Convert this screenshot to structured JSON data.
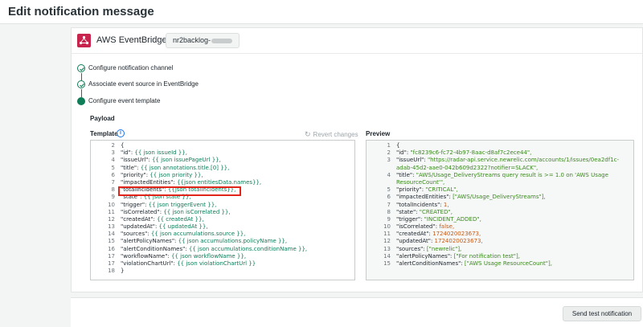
{
  "page": {
    "title": "Edit notification message"
  },
  "header": {
    "provider": "AWS EventBridge /",
    "destination": "nr2backlog-"
  },
  "steps": [
    {
      "label": "Configure notification channel",
      "state": "done"
    },
    {
      "label": "Associate event source in EventBridge",
      "state": "done"
    },
    {
      "label": "Configure event template",
      "state": "current"
    }
  ],
  "payload": {
    "label": "Payload"
  },
  "template": {
    "label": "Template",
    "revert_label": "Revert changes",
    "lines": [
      {
        "n": "2",
        "k": "{",
        "v": ""
      },
      {
        "n": "3",
        "k": "\"id\": ",
        "v": "{{ json issueId }},"
      },
      {
        "n": "4",
        "k": "\"issueUrl\": ",
        "v": "{{ json issuePageUrl }},"
      },
      {
        "n": "5",
        "k": "\"title\": ",
        "v": "{{ json annotations.title.[0] }},"
      },
      {
        "n": "6",
        "k": "\"priority\": ",
        "v": "{{ json priority }},"
      },
      {
        "n": "7",
        "k": "\"impactedEntities\": ",
        "v": "{{json entitiesData.names}},"
      },
      {
        "n": "8",
        "k": "\"totalIncidents\": ",
        "v": "{{json totalIncidents}},"
      },
      {
        "n": "9",
        "k": "\"state\": ",
        "v": "{{ json state }},"
      },
      {
        "n": "10",
        "k": "\"trigger\": ",
        "v": "{{ json triggerEvent }},"
      },
      {
        "n": "11",
        "k": "\"isCorrelated\": ",
        "v": "{{ json isCorrelated }},"
      },
      {
        "n": "12",
        "k": "\"createdAt\": ",
        "v": "{{ createdAt }},"
      },
      {
        "n": "13",
        "k": "\"updatedAt\": ",
        "v": "{{ updatedAt }},"
      },
      {
        "n": "14",
        "k": "\"sources\": ",
        "v": "{{ json accumulations.source }},"
      },
      {
        "n": "15",
        "k": "\"alertPolicyNames\": ",
        "v": "{{ json accumulations.policyName }},"
      },
      {
        "n": "16",
        "k": "\"alertConditionNames\": ",
        "v": "{{ json accumulations.conditionName }},"
      },
      {
        "n": "17",
        "k": "\"workflowName\": ",
        "v": "{{ json workflowName }},"
      },
      {
        "n": "17",
        "k": "\"violationChartUrl\": ",
        "v": "{{ json violationChartUrl }}"
      },
      {
        "n": "18",
        "k": "}",
        "v": ""
      }
    ]
  },
  "preview": {
    "label": "Preview",
    "lines": [
      {
        "n": "1",
        "t": "{",
        "c": "k"
      },
      {
        "n": "2",
        "k": "\"id\": ",
        "v": "\"fc8239c6-fc72-4b97-8aac-d8af7c2ece44\",",
        "c": "s"
      },
      {
        "n": "3",
        "k": "\"issueUrl\": ",
        "v": "\"https://radar-api.service.newrelic.com/accounts/1/issues/0ea2df1c-",
        "c": "s"
      },
      {
        "n": "",
        "k": "",
        "v": "adab-45d2-aae0-042b609d2322?notifier=SLACK\",",
        "c": "s"
      },
      {
        "n": "4",
        "k": "\"title\": ",
        "v": "\"AWS/Usage_DeliveryStreams query result is >= 1.0 on 'AWS Usage",
        "c": "s"
      },
      {
        "n": "",
        "k": "",
        "v": "ResourceCount'\",",
        "c": "s"
      },
      {
        "n": "5",
        "k": "\"priority\": ",
        "v": "\"CRITICAL\",",
        "c": "s"
      },
      {
        "n": "6",
        "k": "\"impactedEntities\": ",
        "v": "[\"AWS/Usage_DeliveryStreams\"],",
        "c": "s"
      },
      {
        "n": "7",
        "k": "\"totalIncidents\": ",
        "v": "1,",
        "c": "n"
      },
      {
        "n": "8",
        "k": "\"state\": ",
        "v": "\"CREATED\",",
        "c": "s"
      },
      {
        "n": "9",
        "k": "\"trigger\": ",
        "v": "\"INCIDENT_ADDED\",",
        "c": "s"
      },
      {
        "n": "10",
        "k": "\"isCorrelated\": ",
        "v": "false,",
        "c": "n"
      },
      {
        "n": "11",
        "k": "\"createdAt\": ",
        "v": "1724020023673,",
        "c": "n"
      },
      {
        "n": "12",
        "k": "\"updatedAt\": ",
        "v": "1724020023673,",
        "c": "n"
      },
      {
        "n": "13",
        "k": "\"sources\": ",
        "v": "[\"newrelic\"],",
        "c": "s"
      },
      {
        "n": "14",
        "k": "\"alertPolicyNames\": ",
        "v": "[\"For notification test\"],",
        "c": "s"
      },
      {
        "n": "15",
        "k": "\"alertConditionNames\": ",
        "v": "[\"AWS Usage ResourceCount\"],",
        "c": "s"
      }
    ]
  },
  "footer": {
    "send_label": "Send test notification"
  },
  "colors": {
    "accent_green": "#0e7d58",
    "brand_eventbridge": "#c7254e",
    "highlight_red": "#e1251b"
  }
}
